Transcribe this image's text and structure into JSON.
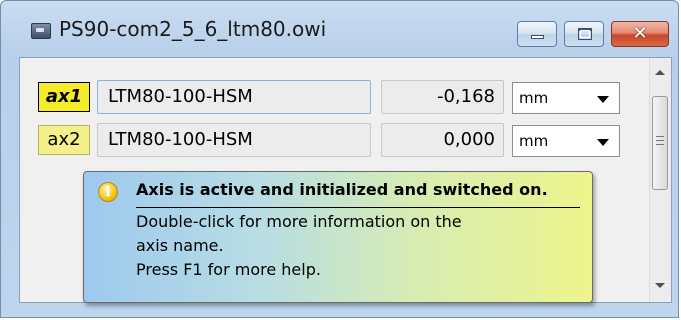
{
  "window": {
    "title": "PS90-com2_5_6_ltm80.owi",
    "close_glyph": "✕",
    "icons": {
      "app": "app-icon",
      "minimize": "minimize-icon",
      "maximize": "maximize-icon",
      "close": "close-icon"
    }
  },
  "axes": [
    {
      "label": "ax1",
      "active": true,
      "name": "LTM80-100-HSM",
      "value": "-0,168",
      "unit": "mm"
    },
    {
      "label": "ax2",
      "active": false,
      "name": "LTM80-100-HSM",
      "value": "0,000",
      "unit": "mm"
    }
  ],
  "tooltip": {
    "icon": "info-icon",
    "icon_glyph": "i",
    "title": "Axis is active and initialized and switched on.",
    "lines": [
      "Double-click for more information on the",
      "axis name.",
      "Press F1 for more help."
    ]
  },
  "colors": {
    "axis_label_active": "#f4eb2a",
    "axis_label_inactive": "#f6f08a",
    "close_button": "#c94729",
    "tooltip_gradient_start": "#9ec9ee",
    "tooltip_gradient_end": "#eef58c"
  }
}
